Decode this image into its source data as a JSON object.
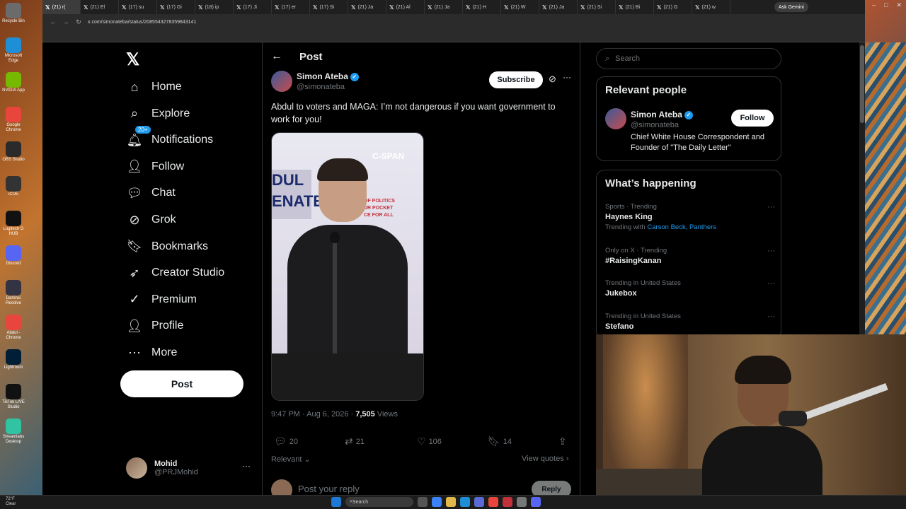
{
  "desktop": {
    "icons": [
      {
        "label": "Recycle Bin",
        "color": "#6b6b6b"
      },
      {
        "label": "Microsoft Edge",
        "color": "#1e8fd6"
      },
      {
        "label": "NVIDIA App",
        "color": "#76b900"
      },
      {
        "label": "Google Chrome",
        "color": "#e8453c"
      },
      {
        "label": "OBS Studio",
        "color": "#2a2a2a"
      },
      {
        "label": "iCUE",
        "color": "#333333"
      },
      {
        "label": "Logitech G HUB",
        "color": "#111111"
      },
      {
        "label": "Discord",
        "color": "#5865f2"
      },
      {
        "label": "DaVinci Resolve",
        "color": "#333344"
      },
      {
        "label": "Abdul - Chrome",
        "color": "#e8453c"
      },
      {
        "label": "Lightroom",
        "color": "#001e36"
      },
      {
        "label": "TikTok LIVE Studio",
        "color": "#111111"
      },
      {
        "label": "Streamlabs Desktop",
        "color": "#31c3a2"
      }
    ]
  },
  "browser": {
    "tabs": [
      {
        "label": "(21) r(",
        "active": true
      },
      {
        "label": "(21) El",
        "active": false
      },
      {
        "label": "(17) su",
        "active": false
      },
      {
        "label": "(17) Gi",
        "active": false
      },
      {
        "label": "(18) ip",
        "active": false
      },
      {
        "label": "(17) Ji",
        "active": false
      },
      {
        "label": "(17) er",
        "active": false
      },
      {
        "label": "(17) Si",
        "active": false
      },
      {
        "label": "(21) Ja",
        "active": false
      },
      {
        "label": "(21) Al",
        "active": false
      },
      {
        "label": "(21) Ja",
        "active": false
      },
      {
        "label": "(21) H",
        "active": false
      },
      {
        "label": "(21) W",
        "active": false
      },
      {
        "label": "(21) Ja",
        "active": false
      },
      {
        "label": "(21) Si",
        "active": false
      },
      {
        "label": "(21) Bi",
        "active": false
      },
      {
        "label": "(21) G",
        "active": false
      },
      {
        "label": "(21) w",
        "active": false
      }
    ],
    "ask_gemini": "Ask Gemini",
    "url": "x.com/simonateba/status/2085543278359843141"
  },
  "sidebar": {
    "logo": "𝕏",
    "items": [
      {
        "label": "Home",
        "icon": "home-icon",
        "glyph": "⌂"
      },
      {
        "label": "Explore",
        "icon": "search-icon",
        "glyph": "⌕"
      },
      {
        "label": "Notifications",
        "icon": "bell-icon",
        "glyph": "🔔︎",
        "badge": "20+"
      },
      {
        "label": "Follow",
        "icon": "add-person-icon",
        "glyph": "👤︎"
      },
      {
        "label": "Chat",
        "icon": "chat-icon",
        "glyph": "💬︎"
      },
      {
        "label": "Grok",
        "icon": "grok-icon",
        "glyph": "⊘"
      },
      {
        "label": "Bookmarks",
        "icon": "bookmark-icon",
        "glyph": "🔖︎"
      },
      {
        "label": "Creator Studio",
        "icon": "rocket-icon",
        "glyph": "➶"
      },
      {
        "label": "Premium",
        "icon": "verified-icon",
        "glyph": "✓"
      },
      {
        "label": "Profile",
        "icon": "person-icon",
        "glyph": "👤︎"
      },
      {
        "label": "More",
        "icon": "more-circle-icon",
        "glyph": "⋯"
      }
    ],
    "post_button": "Post",
    "account": {
      "name": "Mohid",
      "handle": "@PRJMohid",
      "more": "···"
    }
  },
  "main": {
    "back": "←",
    "title": "Post",
    "author": {
      "name": "Simon Ateba",
      "handle": "@simonateba"
    },
    "subscribe": "Subscribe",
    "text": "Abdul to voters and MAGA: I’m not dangerous if you want government to work for you!",
    "video": {
      "banner_left": "DUL\nENATE",
      "banner_right": "OF POLITICS\nUR POCKET\nCE FOR ALL",
      "network": "C-SPAN"
    },
    "time": "9:47 PM · Aug 6, 2026 · ",
    "views_count": "7,505",
    "views_label": " Views",
    "actions": {
      "replies": "20",
      "reposts": "21",
      "likes": "106",
      "bookmarks": "14"
    },
    "relevant": "Relevant",
    "view_quotes": "View quotes",
    "reply_placeholder": "Post your reply",
    "reply_button": "Reply"
  },
  "right": {
    "search_placeholder": "Search",
    "relevant_people": {
      "title": "Relevant people",
      "name": "Simon Ateba",
      "handle": "@simonateba",
      "follow": "Follow",
      "bio": "Chief White House Correspondent and Founder of \"The Daily Letter\""
    },
    "whats_happening": {
      "title": "What’s happening",
      "trends": [
        {
          "meta": "Sports · Trending",
          "name": "Haynes King",
          "with_prefix": "Trending with ",
          "with_links": "Carson Beck, Panthers"
        },
        {
          "meta": "Only on X · Trending",
          "name": "#RaisingKanan"
        },
        {
          "meta": "Trending in United States",
          "name": "Jukebox"
        },
        {
          "meta": "Trending in United States",
          "name": "Stefano"
        }
      ]
    }
  },
  "taskbar": {
    "weather_temp": "72°F",
    "weather_desc": "Clear",
    "search": "Search"
  },
  "colors": {
    "accent": "#1d9bf0",
    "page_bg": "#000000",
    "border": "#2f3336"
  }
}
